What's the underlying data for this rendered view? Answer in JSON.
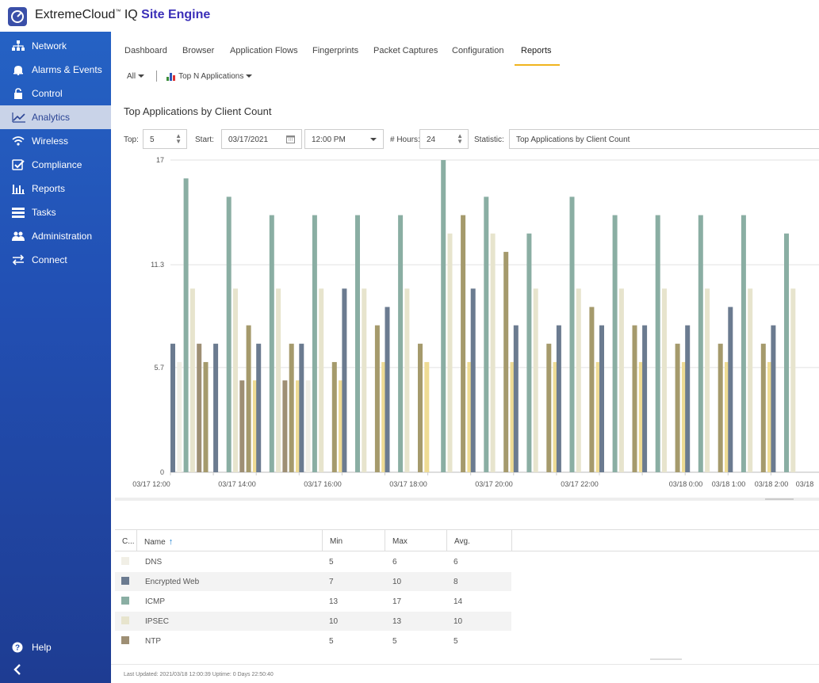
{
  "app": {
    "brand_prefix": "ExtremeCloud",
    "brand_sup": "™",
    "brand_mid": " IQ ",
    "brand_bold": "Site Engine"
  },
  "sidebar": {
    "items": [
      {
        "label": "Network",
        "icon": "network-icon"
      },
      {
        "label": "Alarms & Events",
        "icon": "bell-icon"
      },
      {
        "label": "Control",
        "icon": "lock-icon"
      },
      {
        "label": "Analytics",
        "icon": "analytics-icon",
        "active": true
      },
      {
        "label": "Wireless",
        "icon": "wifi-icon"
      },
      {
        "label": "Compliance",
        "icon": "check-icon"
      },
      {
        "label": "Reports",
        "icon": "reports-icon"
      },
      {
        "label": "Tasks",
        "icon": "tasks-icon"
      },
      {
        "label": "Administration",
        "icon": "users-icon"
      },
      {
        "label": "Connect",
        "icon": "connect-icon"
      }
    ],
    "help_label": "Help"
  },
  "tabs": [
    {
      "label": "Dashboard"
    },
    {
      "label": "Browser"
    },
    {
      "label": "Application Flows"
    },
    {
      "label": "Fingerprints"
    },
    {
      "label": "Packet Captures"
    },
    {
      "label": "Configuration"
    },
    {
      "label": "Reports",
      "active": true
    }
  ],
  "filter": {
    "scope_value": "All",
    "report_select": "Top N Applications"
  },
  "report": {
    "title": "Top Applications by Client Count"
  },
  "params": {
    "top_label": "Top:",
    "top_value": "5",
    "start_label": "Start:",
    "start_date": "03/17/2021",
    "start_time": "12:00 PM",
    "hours_label": "# Hours:",
    "hours_value": "24",
    "statistic_label": "Statistic:",
    "statistic_value": "Top Applications by Client Count"
  },
  "colors": {
    "DNS": "#f1efe6",
    "Encrypted Web": "#6b7b90",
    "ICMP": "#8aaea3",
    "IPSEC": "#e7e4cd",
    "NTP": "#9e8f74",
    "extra_dark": "#a59a6c",
    "extra_light": "#eedb94"
  },
  "chart_data": {
    "type": "bar",
    "ylim": [
      0,
      17
    ],
    "yticks": [
      "0",
      "5.7",
      "11.3",
      "17"
    ],
    "xtick_labels": [
      "03/17 12:00",
      "03/17 14:00",
      "03/17 16:00",
      "03/17 18:00",
      "03/17 20:00",
      "03/17 22:00",
      "03/18 0:00",
      "03/18 1:00",
      "03/18 2:00",
      "03/18"
    ],
    "series_order": [
      "Encrypted Web",
      "DNS",
      "ICMP",
      "IPSEC",
      "NTP",
      "extra_dark",
      "extra_light"
    ],
    "groups": [
      [
        7,
        6,
        16,
        10,
        7,
        6,
        0
      ],
      [
        7,
        0,
        15,
        10,
        5,
        8,
        5
      ],
      [
        7,
        0,
        14,
        10,
        5,
        7,
        5
      ],
      [
        7,
        5,
        14,
        10,
        0,
        6,
        5
      ],
      [
        10,
        0,
        14,
        10,
        0,
        8,
        6
      ],
      [
        9,
        0,
        14,
        10,
        0,
        7,
        6
      ],
      [
        0,
        0,
        17,
        13,
        0,
        14,
        6
      ],
      [
        10,
        0,
        15,
        13,
        0,
        12,
        6
      ],
      [
        8,
        0,
        13,
        10,
        0,
        7,
        6
      ],
      [
        8,
        0,
        15,
        10,
        0,
        9,
        6
      ],
      [
        8,
        0,
        14,
        10,
        0,
        8,
        6
      ],
      [
        8,
        0,
        14,
        10,
        0,
        7,
        6
      ],
      [
        8,
        0,
        14,
        10,
        0,
        7,
        6
      ],
      [
        9,
        0,
        14,
        10,
        0,
        7,
        6
      ],
      [
        8,
        0,
        13,
        10,
        0,
        0,
        0
      ]
    ]
  },
  "table": {
    "columns": [
      "C...",
      "Name",
      "Min",
      "Max",
      "Avg."
    ],
    "rows": [
      {
        "name": "DNS",
        "min": "5",
        "max": "6",
        "avg": "6",
        "color": "#f1efe6"
      },
      {
        "name": "Encrypted Web",
        "min": "7",
        "max": "10",
        "avg": "8",
        "color": "#6b7b90"
      },
      {
        "name": "ICMP",
        "min": "13",
        "max": "17",
        "avg": "14",
        "color": "#8aaea3"
      },
      {
        "name": "IPSEC",
        "min": "10",
        "max": "13",
        "avg": "10",
        "color": "#e7e4cd"
      },
      {
        "name": "NTP",
        "min": "5",
        "max": "5",
        "avg": "5",
        "color": "#9e8f74"
      }
    ]
  },
  "status": {
    "text": "Last Updated: 2021/03/18 12:00:39   Uptime: 0 Days 22:50:40"
  }
}
